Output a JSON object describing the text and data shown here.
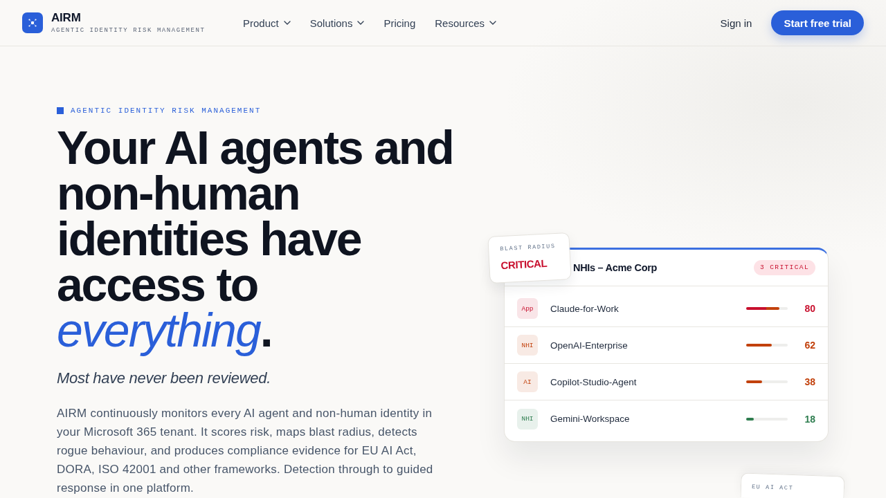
{
  "header": {
    "logo": {
      "name": "AIRM",
      "tagline": "AGENTIC IDENTITY RISK MANAGEMENT"
    },
    "nav": [
      {
        "label": "Product",
        "dropdown": true
      },
      {
        "label": "Solutions",
        "dropdown": true
      },
      {
        "label": "Pricing",
        "dropdown": false
      },
      {
        "label": "Resources",
        "dropdown": true
      }
    ],
    "sign_in": "Sign in",
    "cta": "Start free trial"
  },
  "hero": {
    "eyebrow": "AGENTIC IDENTITY RISK MANAGEMENT",
    "headline": "Your AI agents and non-human identities have access to *everything*.",
    "subheadline": "Most have never been reviewed.",
    "body": "AIRM continuously monitors every AI agent and non-human identity in your Microsoft 365 tenant. It scores risk, maps blast radius, detects rogue behaviour, and produces compliance evidence for EU AI Act, DORA, ISO 42001 and other frameworks. Detection through to guided response in one platform."
  },
  "risk_card": {
    "title": "NHIs – Acme Corp",
    "badge": "3 CRITICAL",
    "rows": [
      {
        "kind": "critical",
        "tag": "App",
        "name": "Claude-for-Work",
        "level": 0.8,
        "score": "80",
        "color": "#c8102e"
      },
      {
        "kind": "standard",
        "tag": "NHI",
        "name": "OpenAI-Enterprise",
        "level": 0.62,
        "score": "62",
        "color": "#c2410c"
      },
      {
        "kind": "standard",
        "tag": "AI",
        "name": "Copilot-Studio-Agent",
        "level": 0.38,
        "score": "38",
        "color": "#c2410c"
      },
      {
        "kind": "standard",
        "tag": "NHI",
        "name": "Gemini-Workspace",
        "level": 0.18,
        "score": "18",
        "color": "#2e7d4f"
      }
    ]
  },
  "blast_radius": {
    "label": "BLAST RADIUS",
    "value": "CRITICAL"
  },
  "compliance_card": {
    "label": "EU AI ACT"
  }
}
